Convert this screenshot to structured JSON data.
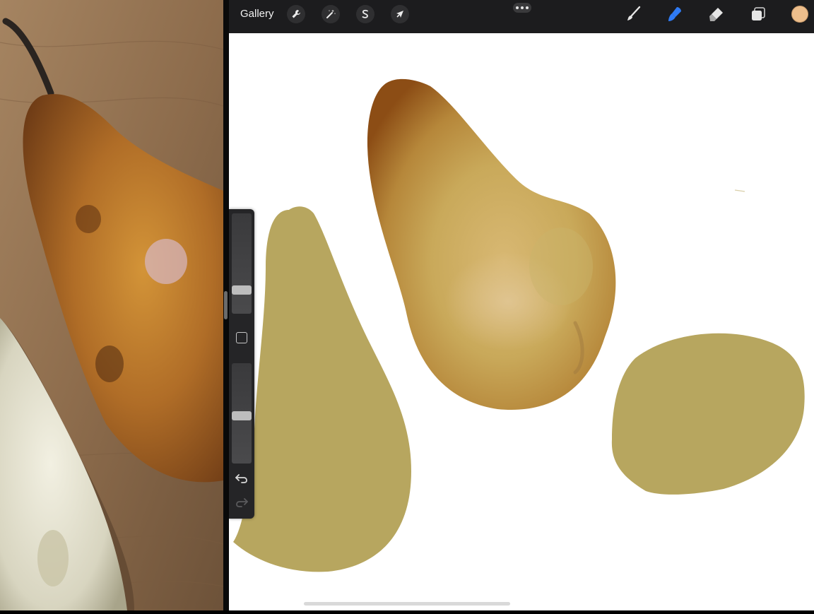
{
  "toolbar": {
    "gallery_label": "Gallery",
    "left_tools": [
      {
        "name": "actions",
        "icon": "wrench-icon"
      },
      {
        "name": "adjustments",
        "icon": "magic-wand-icon"
      },
      {
        "name": "selection",
        "icon": "selection-s-icon"
      },
      {
        "name": "transform",
        "icon": "arrow-cursor-icon"
      }
    ],
    "more_icon": "more-dots-icon",
    "right_tools": [
      {
        "name": "brush",
        "icon": "brush-icon",
        "active": false
      },
      {
        "name": "smudge",
        "icon": "smudge-icon",
        "active": true
      },
      {
        "name": "eraser",
        "icon": "eraser-icon",
        "active": false
      },
      {
        "name": "layers",
        "icon": "layers-icon",
        "active": false
      }
    ],
    "current_color": "#edbe8c",
    "active_color": "#2f7bf5"
  },
  "sidebar": {
    "brush_size": 0.21,
    "brush_opacity": 0.47,
    "modify_icon": "square-icon",
    "undo_icon": "undo-icon",
    "redo_icon": "redo-icon"
  },
  "canvas": {
    "background": "#ffffff",
    "flat_shape_color": "#b7a65f"
  }
}
